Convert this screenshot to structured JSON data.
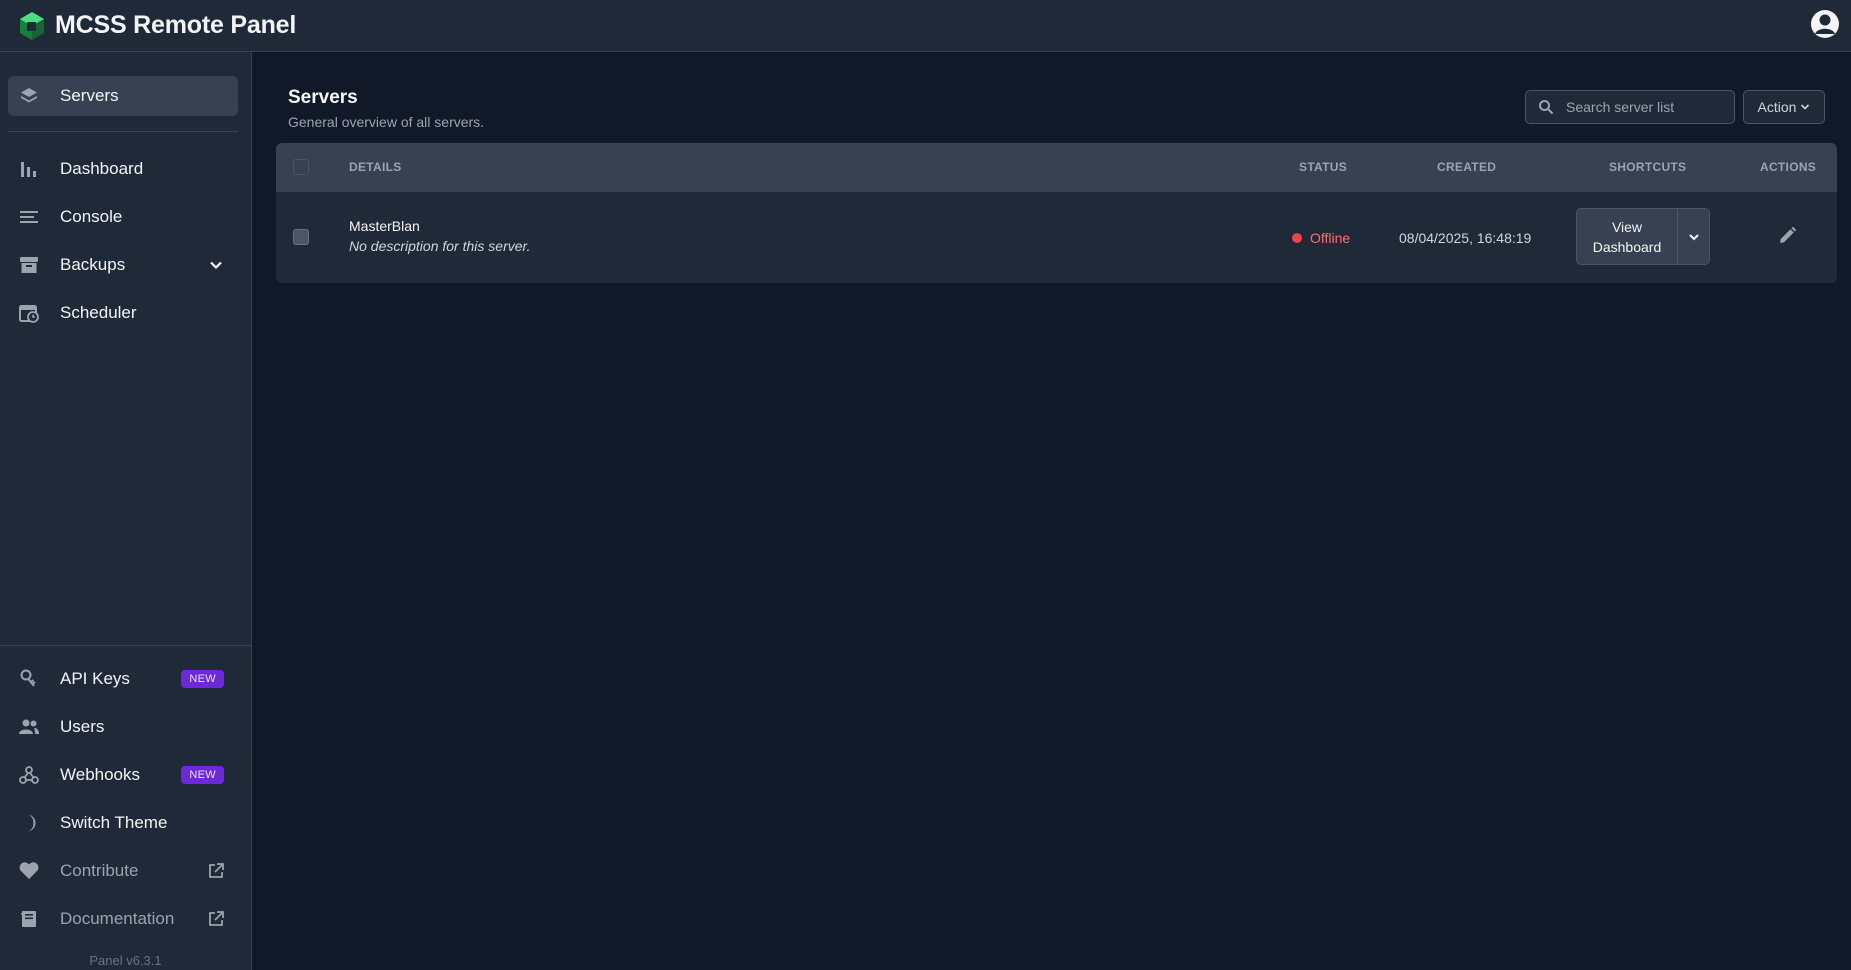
{
  "app": {
    "title": "MCSS Remote Panel",
    "version": "Panel v6.3.1"
  },
  "colors": {
    "accent": "#6d28d9",
    "status_offline": "#ef4444",
    "logo_dark": "#15803d",
    "logo_light": "#4ade80"
  },
  "sidebar": {
    "primary": [
      {
        "label": "Servers",
        "icon": "layers-icon",
        "active": true
      }
    ],
    "items": [
      {
        "label": "Dashboard",
        "icon": "bar-chart-icon"
      },
      {
        "label": "Console",
        "icon": "lines-icon"
      },
      {
        "label": "Backups",
        "icon": "archive-icon",
        "has_submenu": true
      },
      {
        "label": "Scheduler",
        "icon": "calendar-clock-icon"
      }
    ],
    "bottom": [
      {
        "label": "API Keys",
        "icon": "key-icon",
        "badge": "NEW"
      },
      {
        "label": "Users",
        "icon": "users-icon"
      },
      {
        "label": "Webhooks",
        "icon": "webhook-icon",
        "badge": "NEW"
      },
      {
        "label": "Switch Theme",
        "icon": "moon-icon"
      },
      {
        "label": "Contribute",
        "icon": "heart-icon",
        "external": true
      },
      {
        "label": "Documentation",
        "icon": "book-icon",
        "external": true
      }
    ]
  },
  "page": {
    "title": "Servers",
    "subtitle": "General overview of all servers.",
    "search_placeholder": "Search server list",
    "action_label": "Action"
  },
  "table": {
    "headers": {
      "details": "DETAILS",
      "status": "STATUS",
      "created": "CREATED",
      "shortcuts": "SHORTCUTS",
      "actions": "ACTIONS"
    },
    "rows": [
      {
        "name": "MasterBlan",
        "description": "No description for this server.",
        "status": "Offline",
        "created": "08/04/2025, 16:48:19",
        "shortcut_label": "View\nDashboard"
      }
    ]
  }
}
